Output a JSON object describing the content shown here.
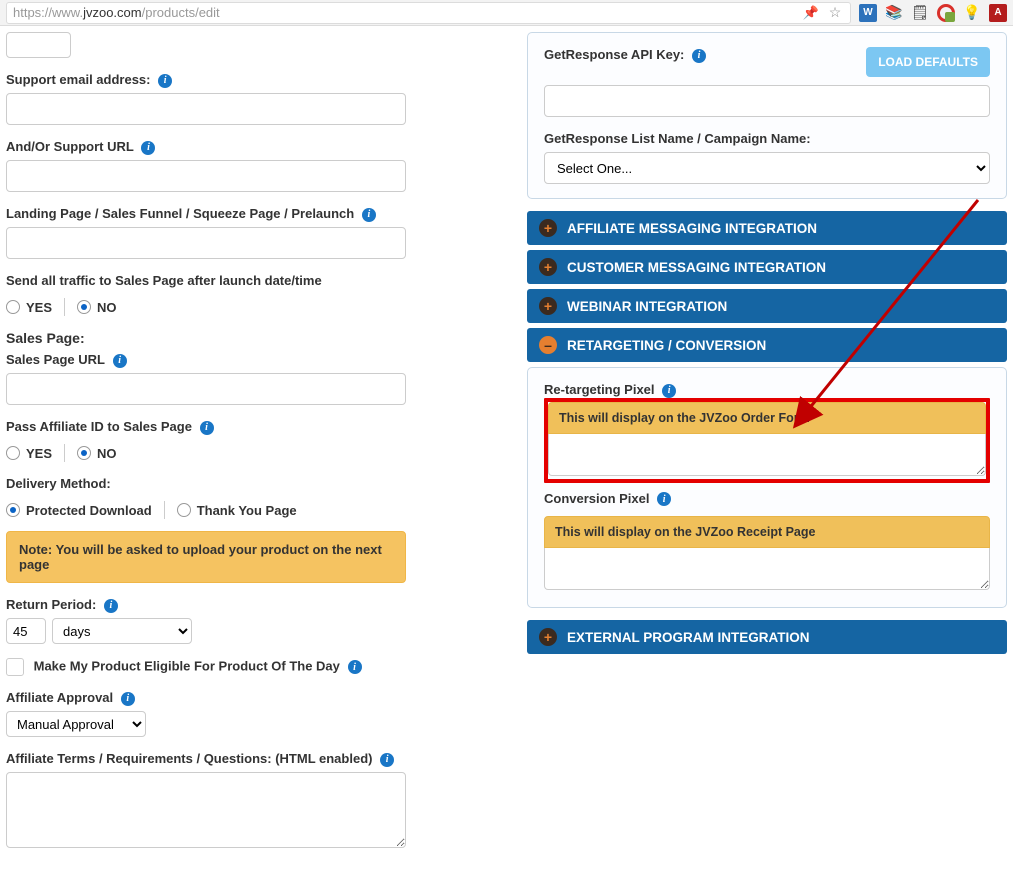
{
  "browser": {
    "url_prefix": "https://www.",
    "url_domain": "jvzoo.com",
    "url_path": "/products/edit"
  },
  "left": {
    "support_email_label": "Support email address:",
    "support_url_label": "And/Or Support URL",
    "landing_label": "Landing Page / Sales Funnel / Squeeze Page / Prelaunch",
    "traffic_label": "Send all traffic to Sales Page after launch date/time",
    "yes": "YES",
    "no": "NO",
    "sales_page_header": "Sales Page:",
    "sales_url_label": "Sales Page URL",
    "pass_affiliate_label": "Pass Affiliate ID to Sales Page",
    "delivery_label": "Delivery Method:",
    "protected": "Protected Download",
    "thank_you": "Thank You Page",
    "note_upload": "Note: You will be asked to upload your product on the next page",
    "return_period_label": "Return Period:",
    "return_value": "45",
    "return_unit": "days",
    "eligible_label": "Make My Product Eligible For Product Of The Day",
    "affiliate_approval_label": "Affiliate Approval",
    "affiliate_approval_value": "Manual Approval",
    "affiliate_terms_label": "Affiliate Terms / Requirements / Questions: (HTML enabled)"
  },
  "right": {
    "gr_key_label": "GetResponse API Key:",
    "load_defaults": "LOAD DEFAULTS",
    "gr_list_label": "GetResponse List Name / Campaign Name:",
    "gr_list_value": "Select One...",
    "sections": {
      "affiliate_msg": "AFFILIATE MESSAGING INTEGRATION",
      "customer_msg": "CUSTOMER MESSAGING INTEGRATION",
      "webinar": "WEBINAR INTEGRATION",
      "retarget": "RETARGETING / CONVERSION",
      "external": "EXTERNAL PROGRAM INTEGRATION"
    },
    "retarget": {
      "pixel_label": "Re-targeting Pixel",
      "pixel_note": "This will display on the JVZoo Order Form",
      "conv_label": "Conversion Pixel",
      "conv_note": "This will display on the JVZoo Receipt Page"
    }
  }
}
